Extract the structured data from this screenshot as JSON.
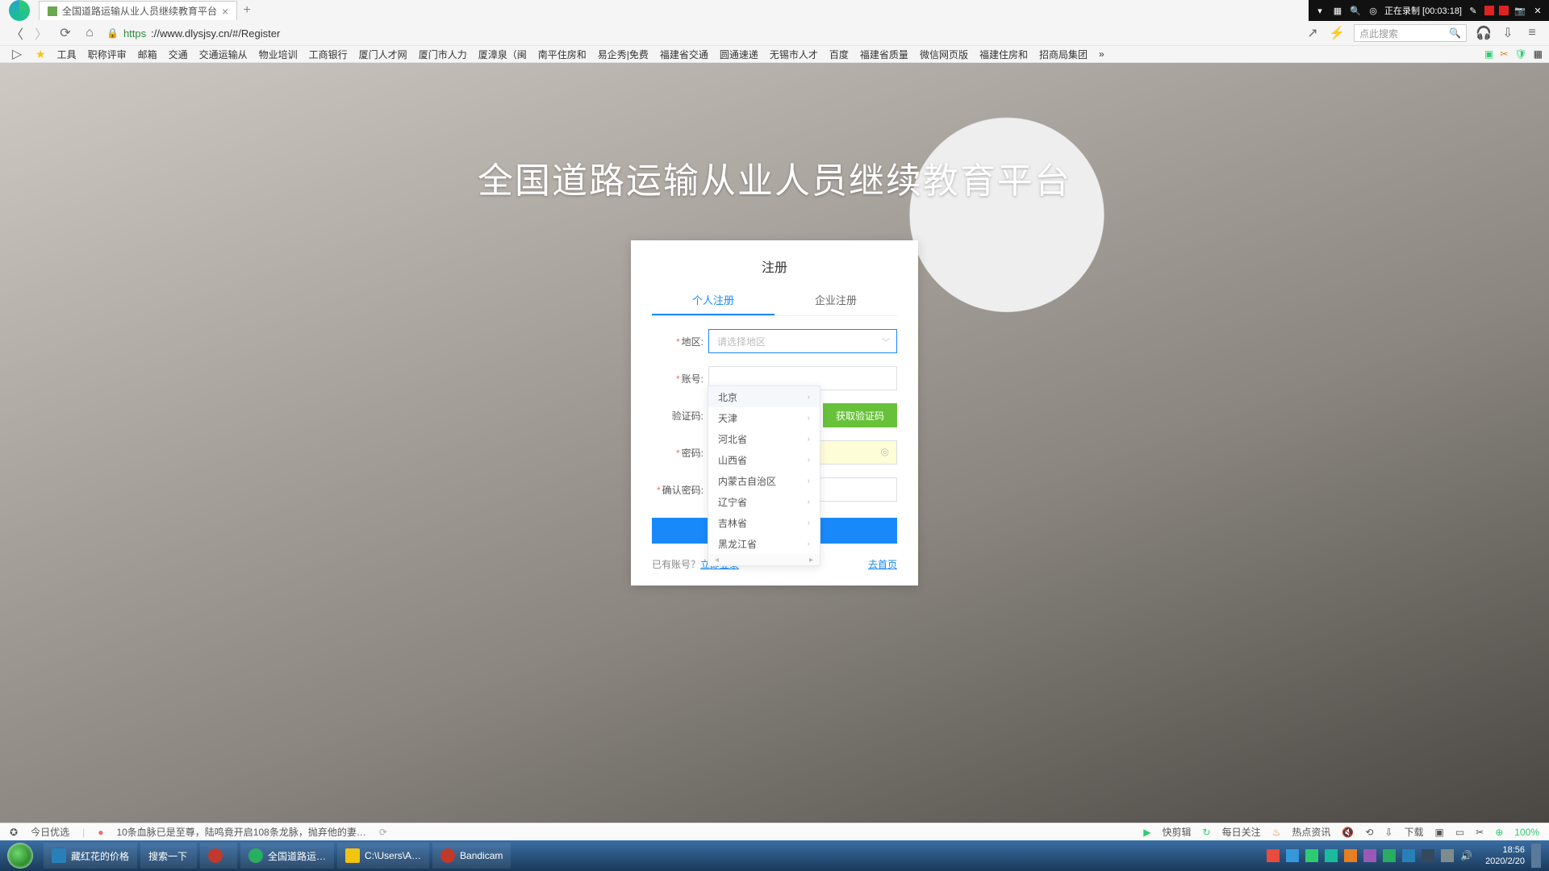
{
  "browser": {
    "tab_title": "全国道路运输从业人员继续教育平台",
    "url_proto": "https",
    "url_rest": "://www.dlysjsy.cn/#/Register",
    "recording": "正在录制 [00:03:18]",
    "search_placeholder": "点此搜索"
  },
  "bookmarks": [
    "工具",
    "职称评审",
    "邮箱",
    "交通",
    "交通运输从",
    "物业培训",
    "工商银行",
    "厦门人才网",
    "厦门市人力",
    "厦漳泉（闽",
    "南平住房和",
    "易企秀|免费",
    "福建省交通",
    "圆通速递",
    "无锡市人才",
    "百度",
    "福建省质量",
    "微信网页版",
    "福建住房和",
    "招商局集团"
  ],
  "page": {
    "title": "全国道路运输从业人员继续教育平台",
    "card_title": "注册",
    "tab_personal": "个人注册",
    "tab_enterprise": "企业注册",
    "labels": {
      "region": "地区:",
      "account": "账号:",
      "captcha": "验证码:",
      "password": "密码:",
      "confirm": "确认密码:"
    },
    "region_placeholder": "请选择地区",
    "captcha_btn": "获取验证码",
    "submit": "",
    "login_prompt": "已有账号？",
    "login_link": "立即登录",
    "home_link": "去首页"
  },
  "dropdown": [
    "北京",
    "天津",
    "河北省",
    "山西省",
    "内蒙古自治区",
    "辽宁省",
    "吉林省",
    "黑龙江省"
  ],
  "status": {
    "left1": "今日优选",
    "left2": "10条血脉已是至尊，陆鸣竟开启108条龙脉，抛弃他的妻…",
    "r1": "快剪辑",
    "r2": "每日关注",
    "r3": "热点资讯",
    "r4": "下载",
    "zoom": "100%"
  },
  "taskbar": {
    "items": [
      {
        "label": "藏红花的价格"
      },
      {
        "label": "搜索一下"
      },
      {
        "label": ""
      },
      {
        "label": "全国道路运…"
      },
      {
        "label": "C:\\Users\\A…"
      },
      {
        "label": "Bandicam"
      }
    ],
    "time": "18:56",
    "date": "2020/2/20"
  }
}
